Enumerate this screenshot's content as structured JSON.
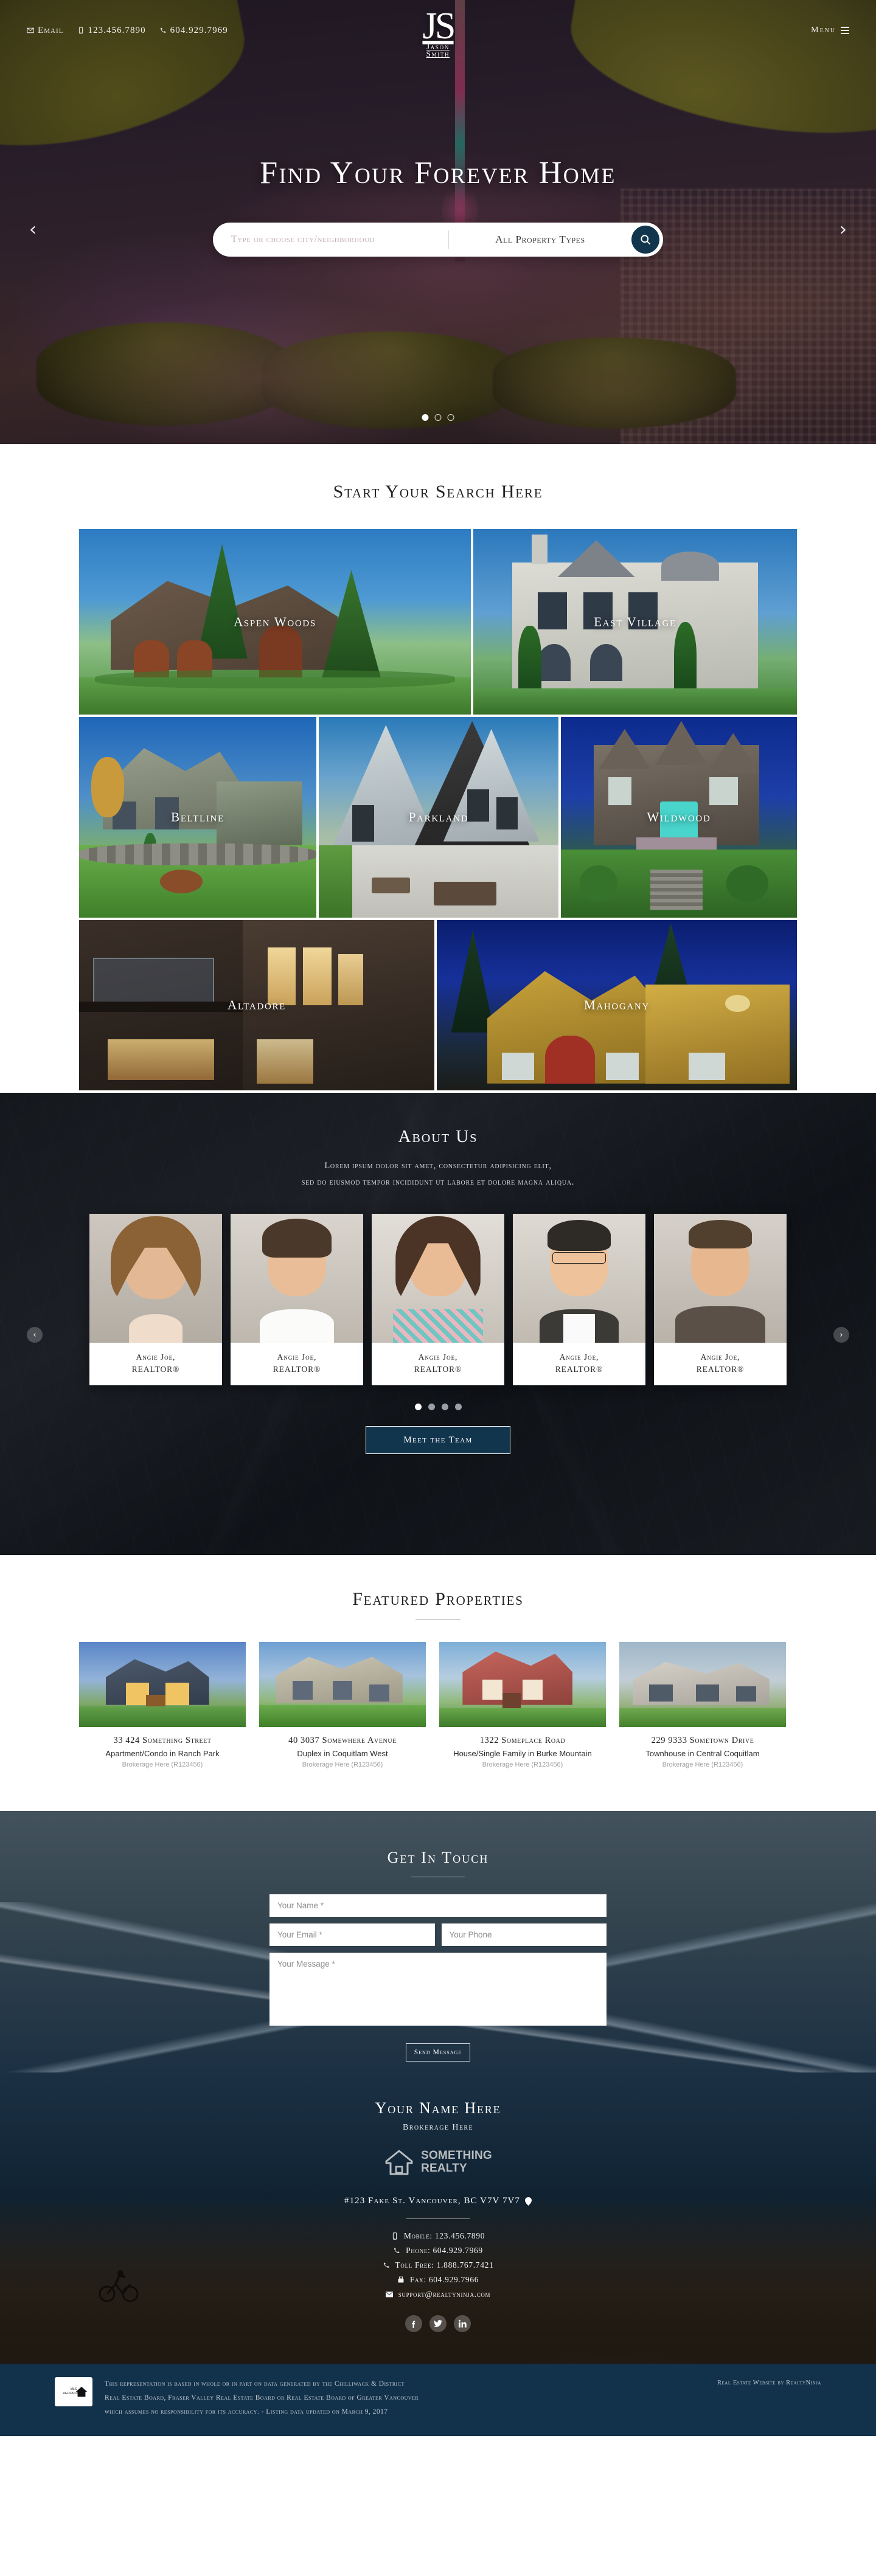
{
  "header": {
    "email_label": "Email",
    "phone_mobile": "123.456.7890",
    "phone_office": "604.929.7969",
    "menu_label": "Menu",
    "logo_initials": "JS",
    "logo_first": "Jason",
    "logo_last": "Smith"
  },
  "hero": {
    "title": "Find Your Forever Home",
    "search_placeholder": "Type or choose city/neighborhood",
    "search_value": "",
    "property_type": "All Property Types",
    "prev_arrow": "‹",
    "next_arrow": "›",
    "slide_count": 3,
    "active_slide": 1
  },
  "search_section": {
    "heading": "Start Your Search Here",
    "neighborhoods": [
      {
        "name": "Aspen Woods"
      },
      {
        "name": "East Village"
      },
      {
        "name": "Beltline"
      },
      {
        "name": "Parkland"
      },
      {
        "name": "Wildwood"
      },
      {
        "name": "Altadore"
      },
      {
        "name": "Mahogany"
      }
    ]
  },
  "about": {
    "heading": "About Us",
    "paragraph_line1": "Lorem ipsum dolor sit amet, consectetur adipisicing elit,",
    "paragraph_line2": "sed do eiusmod tempor incididunt ut labore et dolore magna aliqua.",
    "prev_arrow": "‹",
    "next_arrow": "›",
    "team": [
      {
        "name": "Angie Joe,",
        "title": "REALTOR®"
      },
      {
        "name": "Angie Joe,",
        "title": "REALTOR®"
      },
      {
        "name": "Angie Joe,",
        "title": "REALTOR®"
      },
      {
        "name": "Angie Joe,",
        "title": "REALTOR®"
      },
      {
        "name": "Angie Joe,",
        "title": "REALTOR®"
      }
    ],
    "dot_count": 4,
    "active_dot": 1,
    "cta_label": "Meet the Team"
  },
  "featured": {
    "heading": "Featured Properties",
    "properties": [
      {
        "address": "33 424 Something Street",
        "type": "Apartment/Condo in Ranch Park",
        "brokerage": "Brokerage Here (R123456)"
      },
      {
        "address": "40 3037 Somewhere Avenue",
        "type": "Duplex in Coquitlam West",
        "brokerage": "Brokerage Here (R123456)"
      },
      {
        "address": "1322 Someplace Road",
        "type": "House/Single Family in Burke Mountain",
        "brokerage": "Brokerage Here (R123456)"
      },
      {
        "address": "229 9333 Sometown Drive",
        "type": "Townhouse in Central Coquitlam",
        "brokerage": "Brokerage Here (R123456)"
      }
    ]
  },
  "contact": {
    "heading": "Get In Touch",
    "name_placeholder": "Your Name *",
    "email_placeholder": "Your Email *",
    "phone_placeholder": "Your Phone",
    "message_placeholder": "Your Message *",
    "name_value": "",
    "email_value": "",
    "phone_value": "",
    "message_value": "",
    "submit_label": "Send Message"
  },
  "footer": {
    "agent_name": "Your Name Here",
    "brokerage": "Brokerage Here",
    "logo_line1": "SOMETHING",
    "logo_line2": "REALTY",
    "address": "#123 Fake St.  Vancouver,  BC  V7V 7V7",
    "mobile": "Mobile: 123.456.7890",
    "phone": "Phone: 604.929.7969",
    "toll_free": "Toll Free: 1.888.767.7421",
    "fax": "Fax: 604.929.7966",
    "email": "support@realtyninja.com",
    "socials": [
      "facebook",
      "twitter",
      "linkedin"
    ]
  },
  "legal": {
    "mls_line1": "MLS",
    "mls_line2": "RECIPROCITY",
    "line1": "This representation is based in whole or in part on data generated by the Chilliwack & District",
    "line2": "Real Estate Board, Fraser Valley Real Estate Board or Real Estate Board of Greater Vancouver",
    "line3": "which assumes no responsibility for its accuracy.  - Listing data updated on March 9, 2017",
    "credit": "Real Estate Website by RealtyNinja"
  },
  "colors": {
    "accent_navy": "#12354e",
    "legal_bar": "#12314a"
  }
}
